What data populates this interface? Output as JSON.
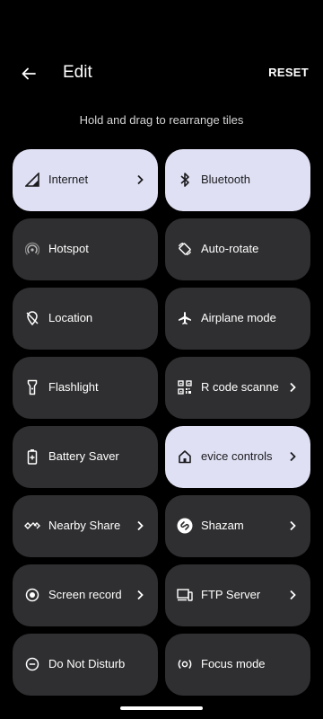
{
  "header": {
    "title": "Edit",
    "reset_label": "RESET",
    "back_icon": "arrow-left-icon"
  },
  "hint": "Hold and drag to rearrange tiles",
  "colors": {
    "background": "#000000",
    "tile": "#2f2f31",
    "tile_active": "#dfe0f3"
  },
  "tiles": [
    {
      "label": "Internet",
      "icon": "signal-icon",
      "active": true,
      "chevron": true
    },
    {
      "label": "Bluetooth",
      "icon": "bluetooth-icon",
      "active": true,
      "chevron": false
    },
    {
      "label": "Hotspot",
      "icon": "hotspot-icon",
      "active": false,
      "chevron": false
    },
    {
      "label": "Auto-rotate",
      "icon": "auto-rotate-icon",
      "active": false,
      "chevron": false
    },
    {
      "label": "Location",
      "icon": "location-off-icon",
      "active": false,
      "chevron": false
    },
    {
      "label": "Airplane mode",
      "icon": "airplane-icon",
      "active": false,
      "chevron": false
    },
    {
      "label": "Flashlight",
      "icon": "flashlight-icon",
      "active": false,
      "chevron": false
    },
    {
      "label": "R code scanne",
      "icon": "qr-code-icon",
      "active": false,
      "chevron": true
    },
    {
      "label": "Battery Saver",
      "icon": "battery-saver-icon",
      "active": false,
      "chevron": false
    },
    {
      "label": "evice controls",
      "icon": "home-icon",
      "active": true,
      "chevron": true
    },
    {
      "label": "Nearby Share",
      "icon": "nearby-share-icon",
      "active": false,
      "chevron": true
    },
    {
      "label": "Shazam",
      "icon": "shazam-icon",
      "active": false,
      "chevron": true
    },
    {
      "label": "Screen record",
      "icon": "screen-record-icon",
      "active": false,
      "chevron": true
    },
    {
      "label": "FTP Server",
      "icon": "ftp-server-icon",
      "active": false,
      "chevron": true
    },
    {
      "label": "Do Not Disturb",
      "icon": "do-not-disturb-icon",
      "active": false,
      "chevron": false
    },
    {
      "label": "Focus mode",
      "icon": "focus-mode-icon",
      "active": false,
      "chevron": false
    }
  ]
}
